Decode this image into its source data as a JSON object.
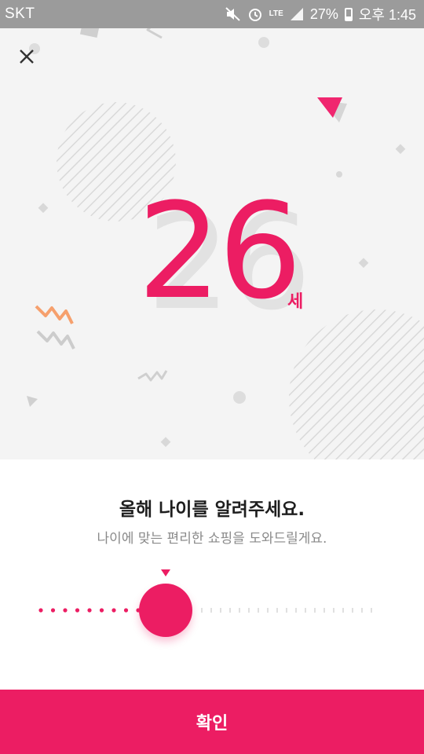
{
  "status_bar": {
    "carrier": "SKT",
    "network": "LTE",
    "battery": "27%",
    "time": "오후 1:45",
    "icons": [
      "mute-vibrate-icon",
      "alarm-icon",
      "lte-icon",
      "signal-icon",
      "battery-icon"
    ]
  },
  "hero": {
    "close_icon": "close-icon",
    "age_value": "26",
    "age_unit": "세"
  },
  "prompt": {
    "title": "올해 나이를 알려주세요.",
    "subtitle": "나이에 맞는 편리한 쇼핑을 도와드릴게요."
  },
  "age_slider": {
    "position_fraction": 0.37
  },
  "confirm_label": "확인",
  "colors": {
    "accent": "#ec1d63",
    "status_bar": "#9b9b9b",
    "hero_background": "#f4f4f4"
  }
}
